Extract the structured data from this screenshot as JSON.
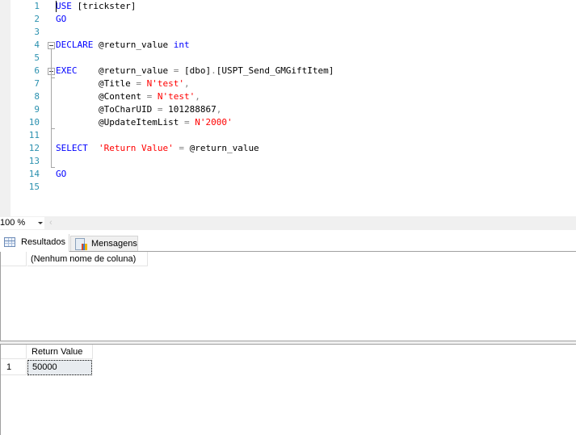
{
  "editor": {
    "lines": [
      {
        "num": "1",
        "tokens": [
          {
            "t": "USE",
            "c": "kw"
          },
          {
            "t": " [trickster]",
            "c": ""
          }
        ]
      },
      {
        "num": "2",
        "tokens": [
          {
            "t": "GO",
            "c": "kw"
          }
        ]
      },
      {
        "num": "3",
        "tokens": []
      },
      {
        "num": "4",
        "tokens": [
          {
            "t": "DECLARE",
            "c": "kw"
          },
          {
            "t": " @return_value ",
            "c": ""
          },
          {
            "t": "int",
            "c": "kw"
          }
        ]
      },
      {
        "num": "5",
        "tokens": []
      },
      {
        "num": "6",
        "tokens": [
          {
            "t": "EXEC",
            "c": "kw"
          },
          {
            "t": "    @return_value ",
            "c": ""
          },
          {
            "t": "=",
            "c": "gray"
          },
          {
            "t": " [dbo]",
            "c": ""
          },
          {
            "t": ".",
            "c": "gray"
          },
          {
            "t": "[USPT_Send_GMGiftItem]",
            "c": ""
          }
        ]
      },
      {
        "num": "7",
        "tokens": [
          {
            "t": "        @Title ",
            "c": ""
          },
          {
            "t": "=",
            "c": "gray"
          },
          {
            "t": " ",
            "c": ""
          },
          {
            "t": "N'test'",
            "c": "str"
          },
          {
            "t": ",",
            "c": "gray"
          }
        ]
      },
      {
        "num": "8",
        "tokens": [
          {
            "t": "        @Content ",
            "c": ""
          },
          {
            "t": "=",
            "c": "gray"
          },
          {
            "t": " ",
            "c": ""
          },
          {
            "t": "N'test'",
            "c": "str"
          },
          {
            "t": ",",
            "c": "gray"
          }
        ]
      },
      {
        "num": "9",
        "tokens": [
          {
            "t": "        @ToCharUID ",
            "c": ""
          },
          {
            "t": "=",
            "c": "gray"
          },
          {
            "t": " 101288867",
            "c": ""
          },
          {
            "t": ",",
            "c": "gray"
          }
        ]
      },
      {
        "num": "10",
        "tokens": [
          {
            "t": "        @UpdateItemList ",
            "c": ""
          },
          {
            "t": "=",
            "c": "gray"
          },
          {
            "t": " ",
            "c": ""
          },
          {
            "t": "N'2000'",
            "c": "str"
          }
        ]
      },
      {
        "num": "11",
        "tokens": []
      },
      {
        "num": "12",
        "tokens": [
          {
            "t": "SELECT",
            "c": "kw"
          },
          {
            "t": "  ",
            "c": ""
          },
          {
            "t": "'Return Value'",
            "c": "str"
          },
          {
            "t": " ",
            "c": ""
          },
          {
            "t": "=",
            "c": "gray"
          },
          {
            "t": " @return_value",
            "c": ""
          }
        ]
      },
      {
        "num": "13",
        "tokens": []
      },
      {
        "num": "14",
        "tokens": [
          {
            "t": "GO",
            "c": "kw"
          }
        ]
      },
      {
        "num": "15",
        "tokens": []
      }
    ]
  },
  "zoom": {
    "value": "100 %",
    "scroll_left": "‹"
  },
  "tabs": {
    "results_label": "Resultados",
    "messages_label": "Mensagens",
    "results_icon": "grid-icon",
    "messages_icon": "messages-icon"
  },
  "result_grid_1": {
    "columns": [
      "(Nenhum nome de coluna)"
    ],
    "rows": []
  },
  "result_grid_2": {
    "columns": [
      "Return Value"
    ],
    "rows": [
      {
        "num": "1",
        "values": [
          "50000"
        ]
      }
    ]
  }
}
